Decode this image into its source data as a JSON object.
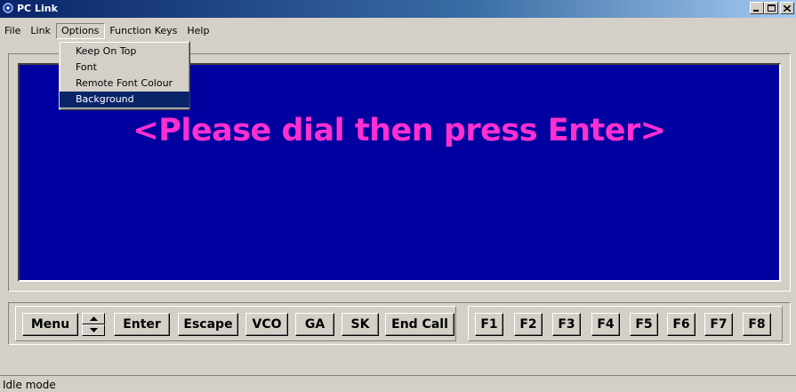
{
  "window": {
    "title": "PC Link",
    "controls": [
      "minimize-icon",
      "maximize-icon",
      "close-icon"
    ]
  },
  "menubar": {
    "items": [
      {
        "label": "File"
      },
      {
        "label": "Link"
      },
      {
        "label": "Options",
        "open": true
      },
      {
        "label": "Function Keys"
      },
      {
        "label": "Help"
      }
    ]
  },
  "options_menu": {
    "items": [
      {
        "label": "Keep On Top"
      },
      {
        "label": "Font"
      },
      {
        "label": "Remote Font Colour"
      },
      {
        "label": "Background",
        "highlighted": true
      }
    ]
  },
  "display": {
    "message": "<Please dial then press Enter>",
    "background_color": "#0000a0",
    "text_color": "#ff2fd0"
  },
  "buttons": {
    "menu": "Menu",
    "enter": "Enter",
    "escape": "Escape",
    "vco": "VCO",
    "ga": "GA",
    "sk": "SK",
    "end_call": "End Call",
    "function_keys": [
      "F1",
      "F2",
      "F3",
      "F4",
      "F5",
      "F6",
      "F7",
      "F8"
    ]
  },
  "status": {
    "text": "Idle mode"
  }
}
